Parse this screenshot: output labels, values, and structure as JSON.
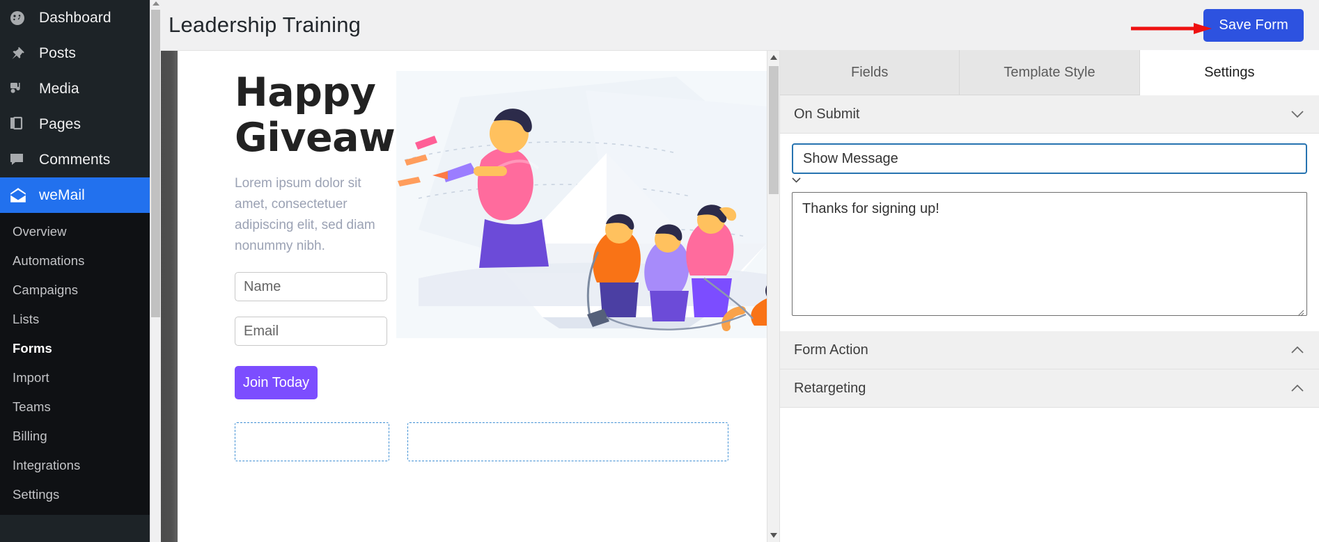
{
  "wp_sidebar": {
    "items": [
      {
        "label": "Dashboard",
        "icon": "dashboard-icon",
        "active": false
      },
      {
        "label": "Posts",
        "icon": "pin-icon",
        "active": false
      },
      {
        "label": "Media",
        "icon": "media-icon",
        "active": false
      },
      {
        "label": "Pages",
        "icon": "pages-icon",
        "active": false
      },
      {
        "label": "Comments",
        "icon": "comment-icon",
        "active": false
      },
      {
        "label": "weMail",
        "icon": "envelope-icon",
        "active": true
      }
    ],
    "submenu": [
      {
        "label": "Overview",
        "current": false
      },
      {
        "label": "Automations",
        "current": false
      },
      {
        "label": "Campaigns",
        "current": false
      },
      {
        "label": "Lists",
        "current": false
      },
      {
        "label": "Forms",
        "current": true
      },
      {
        "label": "Import",
        "current": false
      },
      {
        "label": "Teams",
        "current": false
      },
      {
        "label": "Billing",
        "current": false
      },
      {
        "label": "Integrations",
        "current": false
      },
      {
        "label": "Settings",
        "current": false
      }
    ]
  },
  "header": {
    "title": "Leadership Training",
    "save_label": "Save Form",
    "save_color": "#2d52e0",
    "annotation_color": "#ee1111"
  },
  "form_preview": {
    "heading": "Happy Giveaway",
    "subtext": "Lorem ipsum dolor sit amet, consectetuer adipiscing elit, sed diam nonummy nibh.",
    "name_placeholder": "Name",
    "email_placeholder": "Email",
    "submit_label": "Join Today",
    "submit_color": "#7c4dff",
    "dropzone_color": "#3f8fd4"
  },
  "settings": {
    "tabs": [
      {
        "label": "Fields",
        "active": false
      },
      {
        "label": "Template Style",
        "active": false
      },
      {
        "label": "Settings",
        "active": true
      }
    ],
    "sections": [
      {
        "label": "On Submit",
        "expanded": true,
        "chevron": "chevron-down-icon"
      },
      {
        "label": "Form Action",
        "expanded": false,
        "chevron": "chevron-up-icon"
      },
      {
        "label": "Retargeting",
        "expanded": false,
        "chevron": "chevron-up-icon"
      }
    ],
    "on_submit": {
      "select_value": "Show Message",
      "message_value": "Thanks for signing up!",
      "focus_color": "#2673b0"
    }
  }
}
